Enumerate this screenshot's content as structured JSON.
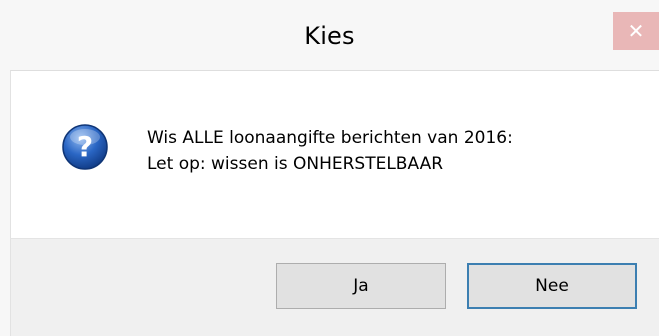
{
  "dialog": {
    "title": "Kies",
    "close_glyph": "✕",
    "icon": "question-icon",
    "message_line1": "Wis ALLE loonaangifte berichten van 2016:",
    "message_line2": "Let op: wissen is ONHERSTELBAAR",
    "buttons": {
      "yes_label": "Ja",
      "no_label": "Nee"
    }
  },
  "colors": {
    "close_button_bg": "#e9b7b7",
    "content_bg": "#ffffff",
    "footer_bg": "#f0f0f0",
    "focused_button_border": "#3c7fb1",
    "icon_blue": "#2a66c4"
  }
}
